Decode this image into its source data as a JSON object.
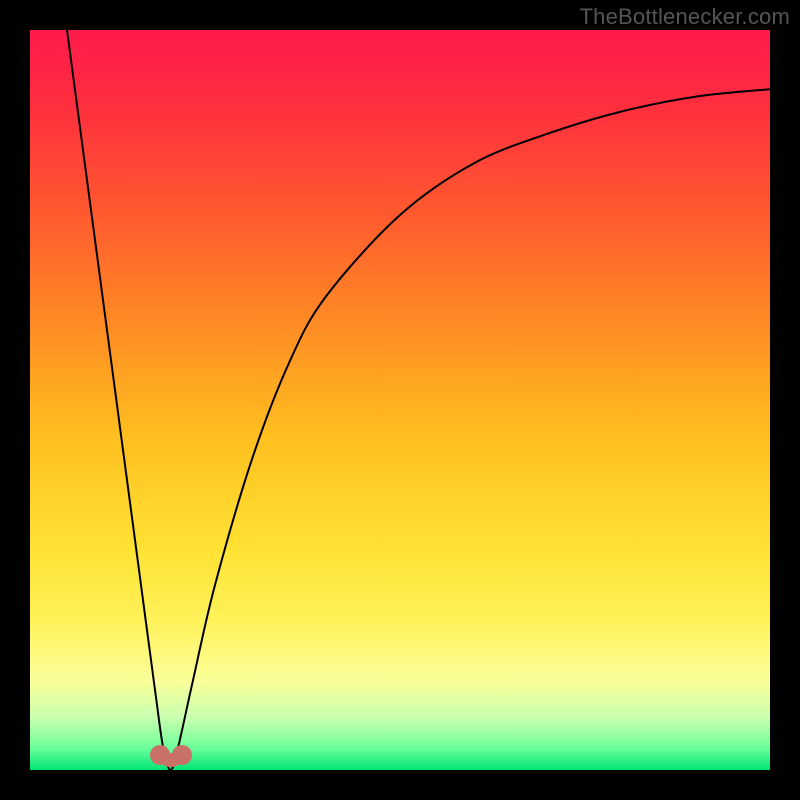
{
  "watermark": {
    "text": "TheBottlenecker.com"
  },
  "chart_data": {
    "type": "line",
    "title": "",
    "xlabel": "",
    "ylabel": "",
    "xlim": [
      0,
      100
    ],
    "ylim": [
      0,
      100
    ],
    "grid": false,
    "legend": false,
    "background_gradient": {
      "stops": [
        {
          "pos": 0.0,
          "color": "#ff1a4b"
        },
        {
          "pos": 0.1,
          "color": "#ff2e3f"
        },
        {
          "pos": 0.25,
          "color": "#ff5a2e"
        },
        {
          "pos": 0.4,
          "color": "#ff8c24"
        },
        {
          "pos": 0.55,
          "color": "#ffbf1f"
        },
        {
          "pos": 0.7,
          "color": "#ffe233"
        },
        {
          "pos": 0.8,
          "color": "#fff25a"
        },
        {
          "pos": 0.88,
          "color": "#faff9a"
        },
        {
          "pos": 0.93,
          "color": "#c8ffb0"
        },
        {
          "pos": 0.97,
          "color": "#6dff9a"
        },
        {
          "pos": 1.0,
          "color": "#00e676"
        }
      ]
    },
    "curve": {
      "color": "#000000",
      "width": 2,
      "minimum_x": 19,
      "points": [
        {
          "x": 5,
          "y": 100
        },
        {
          "x": 7,
          "y": 85
        },
        {
          "x": 9,
          "y": 70
        },
        {
          "x": 11,
          "y": 55
        },
        {
          "x": 13,
          "y": 40
        },
        {
          "x": 15,
          "y": 25
        },
        {
          "x": 17,
          "y": 10
        },
        {
          "x": 18,
          "y": 3
        },
        {
          "x": 19,
          "y": 0
        },
        {
          "x": 20,
          "y": 3
        },
        {
          "x": 22,
          "y": 12
        },
        {
          "x": 25,
          "y": 25
        },
        {
          "x": 30,
          "y": 42
        },
        {
          "x": 35,
          "y": 55
        },
        {
          "x": 40,
          "y": 64
        },
        {
          "x": 50,
          "y": 75
        },
        {
          "x": 60,
          "y": 82
        },
        {
          "x": 70,
          "y": 86
        },
        {
          "x": 80,
          "y": 89
        },
        {
          "x": 90,
          "y": 91
        },
        {
          "x": 100,
          "y": 92
        }
      ]
    },
    "markers": [
      {
        "x": 17.5,
        "y": 2,
        "color": "#c97168"
      },
      {
        "x": 20.5,
        "y": 2,
        "color": "#c97168"
      }
    ]
  }
}
